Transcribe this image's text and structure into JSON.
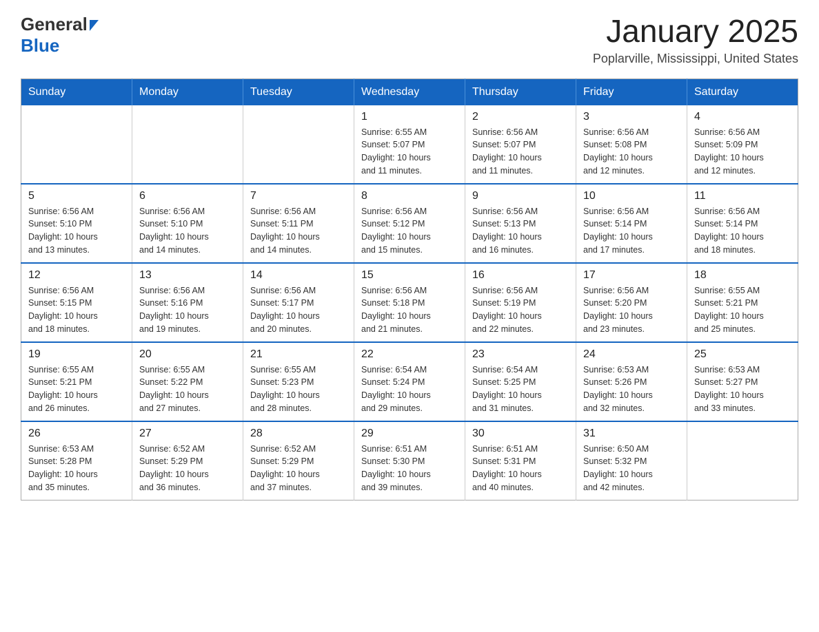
{
  "logo": {
    "text_general": "General",
    "arrow": "▶",
    "text_blue": "Blue"
  },
  "header": {
    "title": "January 2025",
    "subtitle": "Poplarville, Mississippi, United States"
  },
  "weekdays": [
    "Sunday",
    "Monday",
    "Tuesday",
    "Wednesday",
    "Thursday",
    "Friday",
    "Saturday"
  ],
  "weeks": [
    [
      {
        "day": "",
        "info": ""
      },
      {
        "day": "",
        "info": ""
      },
      {
        "day": "",
        "info": ""
      },
      {
        "day": "1",
        "info": "Sunrise: 6:55 AM\nSunset: 5:07 PM\nDaylight: 10 hours\nand 11 minutes."
      },
      {
        "day": "2",
        "info": "Sunrise: 6:56 AM\nSunset: 5:07 PM\nDaylight: 10 hours\nand 11 minutes."
      },
      {
        "day": "3",
        "info": "Sunrise: 6:56 AM\nSunset: 5:08 PM\nDaylight: 10 hours\nand 12 minutes."
      },
      {
        "day": "4",
        "info": "Sunrise: 6:56 AM\nSunset: 5:09 PM\nDaylight: 10 hours\nand 12 minutes."
      }
    ],
    [
      {
        "day": "5",
        "info": "Sunrise: 6:56 AM\nSunset: 5:10 PM\nDaylight: 10 hours\nand 13 minutes."
      },
      {
        "day": "6",
        "info": "Sunrise: 6:56 AM\nSunset: 5:10 PM\nDaylight: 10 hours\nand 14 minutes."
      },
      {
        "day": "7",
        "info": "Sunrise: 6:56 AM\nSunset: 5:11 PM\nDaylight: 10 hours\nand 14 minutes."
      },
      {
        "day": "8",
        "info": "Sunrise: 6:56 AM\nSunset: 5:12 PM\nDaylight: 10 hours\nand 15 minutes."
      },
      {
        "day": "9",
        "info": "Sunrise: 6:56 AM\nSunset: 5:13 PM\nDaylight: 10 hours\nand 16 minutes."
      },
      {
        "day": "10",
        "info": "Sunrise: 6:56 AM\nSunset: 5:14 PM\nDaylight: 10 hours\nand 17 minutes."
      },
      {
        "day": "11",
        "info": "Sunrise: 6:56 AM\nSunset: 5:14 PM\nDaylight: 10 hours\nand 18 minutes."
      }
    ],
    [
      {
        "day": "12",
        "info": "Sunrise: 6:56 AM\nSunset: 5:15 PM\nDaylight: 10 hours\nand 18 minutes."
      },
      {
        "day": "13",
        "info": "Sunrise: 6:56 AM\nSunset: 5:16 PM\nDaylight: 10 hours\nand 19 minutes."
      },
      {
        "day": "14",
        "info": "Sunrise: 6:56 AM\nSunset: 5:17 PM\nDaylight: 10 hours\nand 20 minutes."
      },
      {
        "day": "15",
        "info": "Sunrise: 6:56 AM\nSunset: 5:18 PM\nDaylight: 10 hours\nand 21 minutes."
      },
      {
        "day": "16",
        "info": "Sunrise: 6:56 AM\nSunset: 5:19 PM\nDaylight: 10 hours\nand 22 minutes."
      },
      {
        "day": "17",
        "info": "Sunrise: 6:56 AM\nSunset: 5:20 PM\nDaylight: 10 hours\nand 23 minutes."
      },
      {
        "day": "18",
        "info": "Sunrise: 6:55 AM\nSunset: 5:21 PM\nDaylight: 10 hours\nand 25 minutes."
      }
    ],
    [
      {
        "day": "19",
        "info": "Sunrise: 6:55 AM\nSunset: 5:21 PM\nDaylight: 10 hours\nand 26 minutes."
      },
      {
        "day": "20",
        "info": "Sunrise: 6:55 AM\nSunset: 5:22 PM\nDaylight: 10 hours\nand 27 minutes."
      },
      {
        "day": "21",
        "info": "Sunrise: 6:55 AM\nSunset: 5:23 PM\nDaylight: 10 hours\nand 28 minutes."
      },
      {
        "day": "22",
        "info": "Sunrise: 6:54 AM\nSunset: 5:24 PM\nDaylight: 10 hours\nand 29 minutes."
      },
      {
        "day": "23",
        "info": "Sunrise: 6:54 AM\nSunset: 5:25 PM\nDaylight: 10 hours\nand 31 minutes."
      },
      {
        "day": "24",
        "info": "Sunrise: 6:53 AM\nSunset: 5:26 PM\nDaylight: 10 hours\nand 32 minutes."
      },
      {
        "day": "25",
        "info": "Sunrise: 6:53 AM\nSunset: 5:27 PM\nDaylight: 10 hours\nand 33 minutes."
      }
    ],
    [
      {
        "day": "26",
        "info": "Sunrise: 6:53 AM\nSunset: 5:28 PM\nDaylight: 10 hours\nand 35 minutes."
      },
      {
        "day": "27",
        "info": "Sunrise: 6:52 AM\nSunset: 5:29 PM\nDaylight: 10 hours\nand 36 minutes."
      },
      {
        "day": "28",
        "info": "Sunrise: 6:52 AM\nSunset: 5:29 PM\nDaylight: 10 hours\nand 37 minutes."
      },
      {
        "day": "29",
        "info": "Sunrise: 6:51 AM\nSunset: 5:30 PM\nDaylight: 10 hours\nand 39 minutes."
      },
      {
        "day": "30",
        "info": "Sunrise: 6:51 AM\nSunset: 5:31 PM\nDaylight: 10 hours\nand 40 minutes."
      },
      {
        "day": "31",
        "info": "Sunrise: 6:50 AM\nSunset: 5:32 PM\nDaylight: 10 hours\nand 42 minutes."
      },
      {
        "day": "",
        "info": ""
      }
    ]
  ]
}
